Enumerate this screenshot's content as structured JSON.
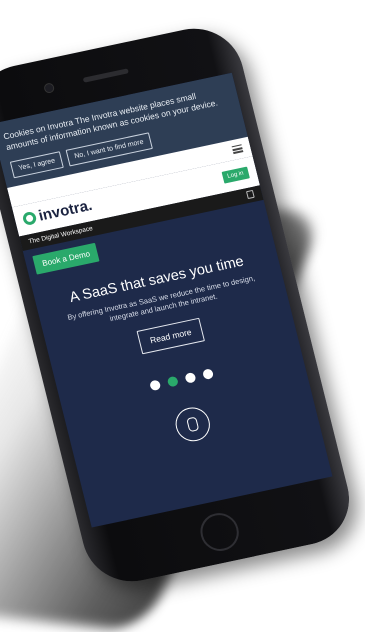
{
  "cookie_banner": {
    "text": "Cookies on Invotra The Invotra website places small amounts of information known as cookies on your device.",
    "agree_label": "Yes, I agree",
    "more_label": "No, I want to find more"
  },
  "header": {
    "logo": "invotra.",
    "login_label": "Log in",
    "tagline": "The Digital Workspace"
  },
  "cta": {
    "demo_label": "Book a Demo"
  },
  "hero": {
    "title": "A SaaS that saves you time",
    "body": "By offering Invotra as SaaS we reduce the time to design, integrate and launch the intranet.",
    "read_more_label": "Read more"
  },
  "carousel": {
    "active_index": 1,
    "count": 4
  },
  "colors": {
    "accent": "#2aa96b",
    "hero_bg": "#1e2a4a",
    "cookie_bg": "#2e3e55"
  }
}
